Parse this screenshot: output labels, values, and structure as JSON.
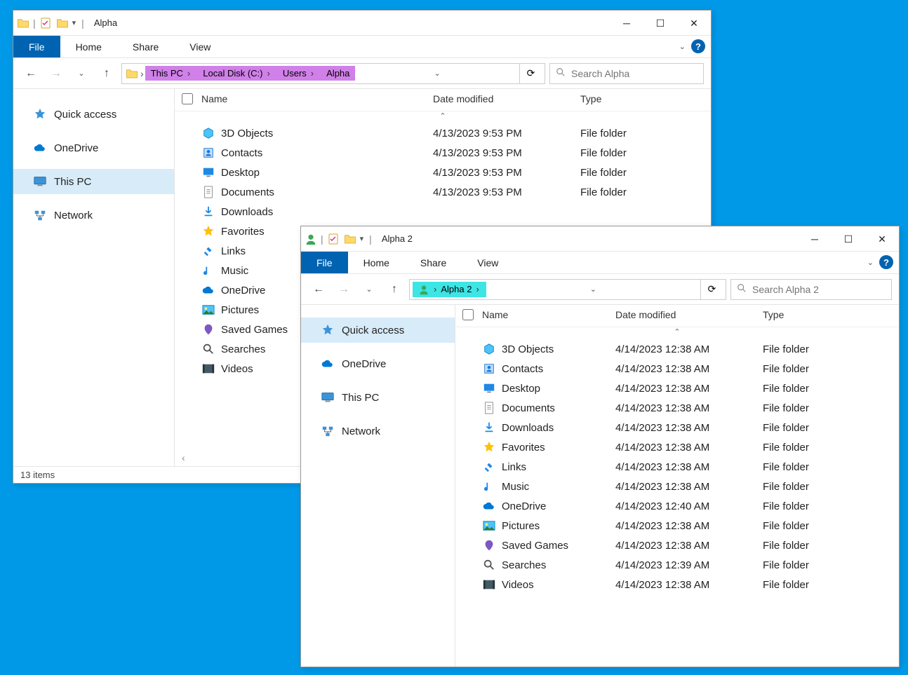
{
  "window1": {
    "title": "Alpha",
    "ribbon": {
      "file": "File",
      "tabs": [
        "Home",
        "Share",
        "View"
      ]
    },
    "breadcrumb": [
      {
        "label": "This PC",
        "hl": true
      },
      {
        "label": "Local Disk (C:)",
        "hl": true
      },
      {
        "label": "Users",
        "hl": true
      },
      {
        "label": "Alpha",
        "hl": true
      }
    ],
    "search_placeholder": "Search Alpha",
    "nav": [
      {
        "label": "Quick access",
        "icon": "star"
      },
      {
        "label": "OneDrive",
        "icon": "cloud"
      },
      {
        "label": "This PC",
        "icon": "pc",
        "selected": true
      },
      {
        "label": "Network",
        "icon": "network"
      }
    ],
    "columns": {
      "name": "Name",
      "date": "Date modified",
      "type": "Type"
    },
    "items": [
      {
        "name": "3D Objects",
        "date": "4/13/2023 9:53 PM",
        "type": "File folder",
        "icon": "3d"
      },
      {
        "name": "Contacts",
        "date": "4/13/2023 9:53 PM",
        "type": "File folder",
        "icon": "contacts"
      },
      {
        "name": "Desktop",
        "date": "4/13/2023 9:53 PM",
        "type": "File folder",
        "icon": "desktop"
      },
      {
        "name": "Documents",
        "date": "4/13/2023 9:53 PM",
        "type": "File folder",
        "icon": "doc"
      },
      {
        "name": "Downloads",
        "date": "",
        "type": "",
        "icon": "down"
      },
      {
        "name": "Favorites",
        "date": "",
        "type": "",
        "icon": "fav"
      },
      {
        "name": "Links",
        "date": "",
        "type": "",
        "icon": "link"
      },
      {
        "name": "Music",
        "date": "",
        "type": "",
        "icon": "music"
      },
      {
        "name": "OneDrive",
        "date": "",
        "type": "",
        "icon": "cloud"
      },
      {
        "name": "Pictures",
        "date": "",
        "type": "",
        "icon": "pic"
      },
      {
        "name": "Saved Games",
        "date": "",
        "type": "",
        "icon": "games"
      },
      {
        "name": "Searches",
        "date": "",
        "type": "",
        "icon": "search"
      },
      {
        "name": "Videos",
        "date": "",
        "type": "",
        "icon": "video"
      }
    ],
    "status": "13 items"
  },
  "window2": {
    "title": "Alpha 2",
    "ribbon": {
      "file": "File",
      "tabs": [
        "Home",
        "Share",
        "View"
      ]
    },
    "breadcrumb": [
      {
        "label": "Alpha 2",
        "hl": true
      }
    ],
    "search_placeholder": "Search Alpha 2",
    "nav": [
      {
        "label": "Quick access",
        "icon": "star",
        "selected": true
      },
      {
        "label": "OneDrive",
        "icon": "cloud"
      },
      {
        "label": "This PC",
        "icon": "pc"
      },
      {
        "label": "Network",
        "icon": "network"
      }
    ],
    "columns": {
      "name": "Name",
      "date": "Date modified",
      "type": "Type"
    },
    "items": [
      {
        "name": "3D Objects",
        "date": "4/14/2023 12:38 AM",
        "type": "File folder",
        "icon": "3d"
      },
      {
        "name": "Contacts",
        "date": "4/14/2023 12:38 AM",
        "type": "File folder",
        "icon": "contacts"
      },
      {
        "name": "Desktop",
        "date": "4/14/2023 12:38 AM",
        "type": "File folder",
        "icon": "desktop"
      },
      {
        "name": "Documents",
        "date": "4/14/2023 12:38 AM",
        "type": "File folder",
        "icon": "doc"
      },
      {
        "name": "Downloads",
        "date": "4/14/2023 12:38 AM",
        "type": "File folder",
        "icon": "down"
      },
      {
        "name": "Favorites",
        "date": "4/14/2023 12:38 AM",
        "type": "File folder",
        "icon": "fav"
      },
      {
        "name": "Links",
        "date": "4/14/2023 12:38 AM",
        "type": "File folder",
        "icon": "link"
      },
      {
        "name": "Music",
        "date": "4/14/2023 12:38 AM",
        "type": "File folder",
        "icon": "music"
      },
      {
        "name": "OneDrive",
        "date": "4/14/2023 12:40 AM",
        "type": "File folder",
        "icon": "cloud"
      },
      {
        "name": "Pictures",
        "date": "4/14/2023 12:38 AM",
        "type": "File folder",
        "icon": "pic"
      },
      {
        "name": "Saved Games",
        "date": "4/14/2023 12:38 AM",
        "type": "File folder",
        "icon": "games"
      },
      {
        "name": "Searches",
        "date": "4/14/2023 12:39 AM",
        "type": "File folder",
        "icon": "search"
      },
      {
        "name": "Videos",
        "date": "4/14/2023 12:38 AM",
        "type": "File folder",
        "icon": "video"
      }
    ]
  }
}
